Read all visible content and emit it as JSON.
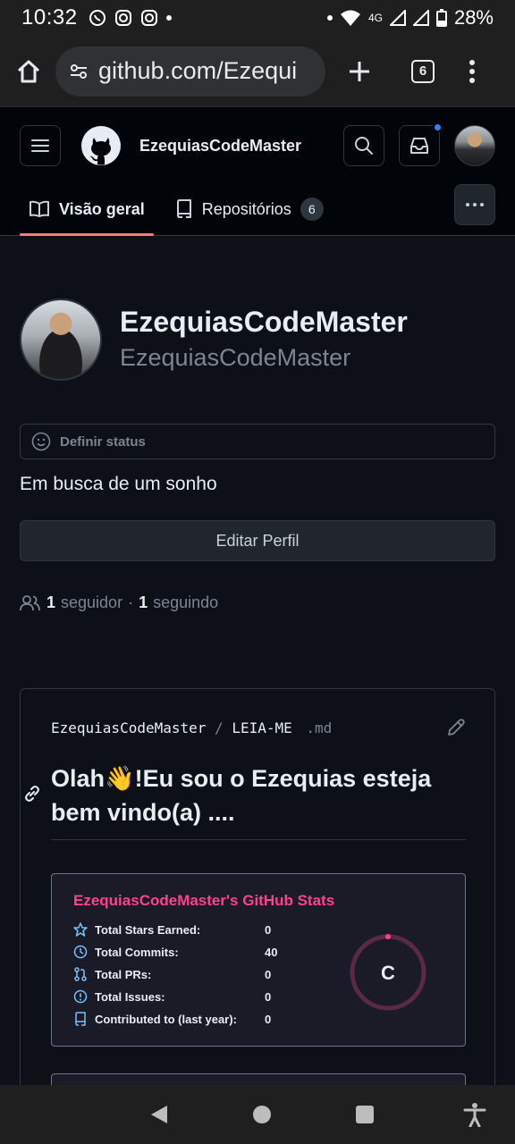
{
  "status_bar": {
    "time": "10:32",
    "network": "4G",
    "battery": "28%"
  },
  "browser": {
    "url": "github.com/Ezequi",
    "tab_count": "6"
  },
  "header": {
    "username": "EzequiasCodeMaster"
  },
  "tabs": [
    {
      "label": "Visão geral"
    },
    {
      "label": "Repositórios",
      "count": "6"
    }
  ],
  "profile": {
    "name": "EzequiasCodeMaster",
    "login": "EzequiasCodeMaster",
    "status_placeholder": "Definir status",
    "bio": "Em busca de um sonho",
    "edit_label": "Editar Perfil",
    "followers_count": "1",
    "followers_label": "seguidor",
    "separator": "·",
    "following_count": "1",
    "following_label": "seguindo"
  },
  "readme": {
    "repo": "EzequiasCodeMaster",
    "slash": "/",
    "file": "LEIA-ME",
    "ext": ".md",
    "title": "Olah👋!Eu sou o Ezequias esteja bem vindo(a) ...."
  },
  "stats_card": {
    "title": "EzequiasCodeMaster's GitHub Stats",
    "rows": [
      {
        "icon": "star-icon",
        "label": "Total Stars Earned:",
        "value": "0"
      },
      {
        "icon": "history-icon",
        "label": "Total Commits:",
        "value": "40"
      },
      {
        "icon": "pull-request-icon",
        "label": "Total PRs:",
        "value": "0"
      },
      {
        "icon": "issue-icon",
        "label": "Total Issues:",
        "value": "0"
      },
      {
        "icon": "repo-icon",
        "label": "Contributed to (last year):",
        "value": "0"
      }
    ],
    "grade": "C",
    "accent": "#fe428e",
    "icon_color": "#79c0ff"
  }
}
